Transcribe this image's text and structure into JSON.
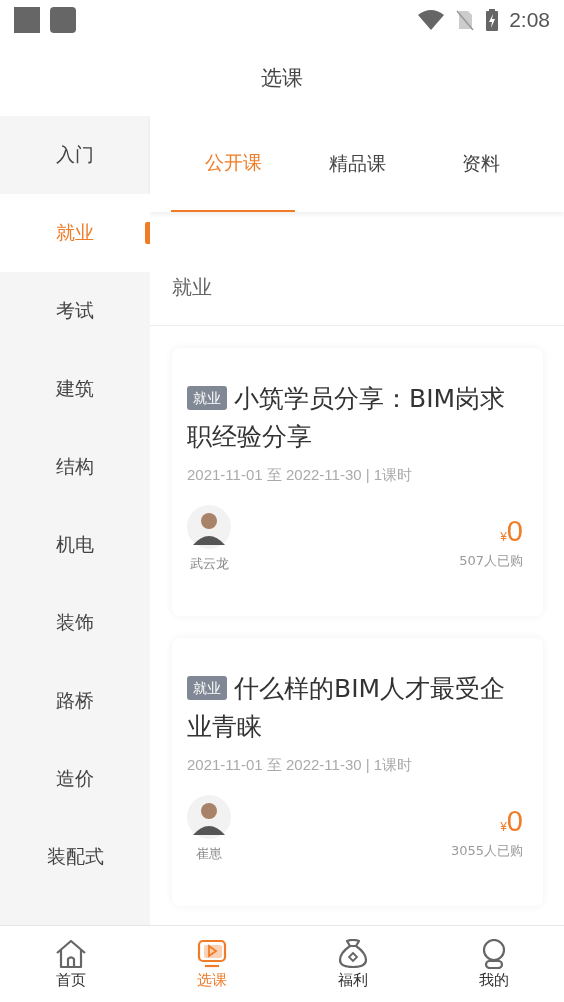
{
  "status_bar": {
    "time": "2:08"
  },
  "header": {
    "title": "选课"
  },
  "sidebar": {
    "items": [
      {
        "label": "入门",
        "selected": false
      },
      {
        "label": "就业",
        "selected": true
      },
      {
        "label": "考试",
        "selected": false
      },
      {
        "label": "建筑",
        "selected": false
      },
      {
        "label": "结构",
        "selected": false
      },
      {
        "label": "机电",
        "selected": false
      },
      {
        "label": "装饰",
        "selected": false
      },
      {
        "label": "路桥",
        "selected": false
      },
      {
        "label": "造价",
        "selected": false
      },
      {
        "label": "装配式",
        "selected": false
      }
    ]
  },
  "tabs": [
    {
      "label": "公开课",
      "selected": true
    },
    {
      "label": "精品课",
      "selected": false
    },
    {
      "label": "资料",
      "selected": false
    }
  ],
  "section_title": "就业",
  "courses": [
    {
      "tag": "就业",
      "title": "小筑学员分享：BIM岗求职经验分享",
      "schedule": "2021-11-01 至 2022-11-30 | 1课时",
      "teacher": "武云龙",
      "currency": "¥",
      "price": "0",
      "buyers": "507人已购"
    },
    {
      "tag": "就业",
      "title": "什么样的BIM人才最受企业青睐",
      "schedule": "2021-11-01 至 2022-11-30 | 1课时",
      "teacher": "崔崽",
      "currency": "¥",
      "price": "0",
      "buyers": "3055人已购"
    }
  ],
  "bottom_nav": [
    {
      "kind": "home",
      "label": "首页",
      "selected": false
    },
    {
      "kind": "courses",
      "label": "选课",
      "selected": true
    },
    {
      "kind": "welfare",
      "label": "福利",
      "selected": false
    },
    {
      "kind": "profile",
      "label": "我的",
      "selected": false
    }
  ]
}
